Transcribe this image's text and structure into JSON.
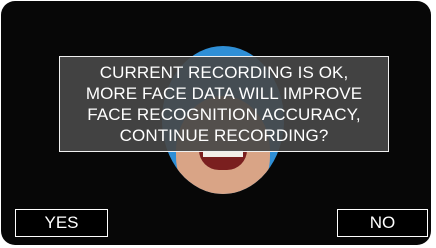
{
  "dialog": {
    "message_lines": [
      "CURRENT RECORDING IS OK,",
      "MORE FACE DATA WILL IMPROVE",
      "FACE RECOGNITION ACCURACY,",
      "CONTINUE RECORDING?"
    ]
  },
  "buttons": {
    "yes_label": "YES",
    "no_label": "NO"
  },
  "colors": {
    "screen_background": "#070707",
    "panel_background": "#484848",
    "panel_border": "#f0f0f0",
    "text": "#ffffff",
    "preview_background": "#2f8fd6"
  }
}
